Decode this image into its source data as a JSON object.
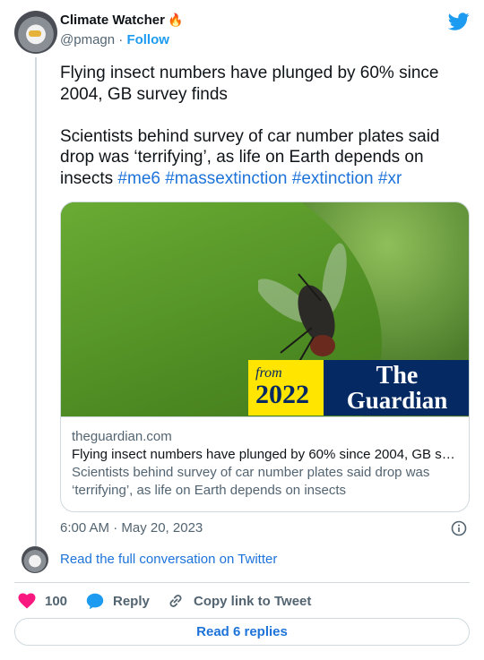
{
  "author": {
    "name": "Climate Watcher",
    "emoji": "🔥",
    "handle": "@pmagn",
    "separator": "·",
    "follow_label": "Follow"
  },
  "tweet": {
    "paragraph1": "Flying insect numbers have plunged by 60% since 2004, GB survey finds",
    "paragraph2_text": "Scientists behind survey of car number plates said drop was ‘terrifying’, as life on Earth depends on insects",
    "hashtags": [
      "#me6",
      "#massextinction",
      "#extinction",
      "#xr"
    ]
  },
  "card": {
    "badge_from": "from",
    "badge_year": "2022",
    "badge_brand_line1": "The",
    "badge_brand_line2": "Guardian",
    "domain": "theguardian.com",
    "title": "Flying insect numbers have plunged by 60% since 2004, GB su…",
    "description": "Scientists behind survey of car number plates said drop was ‘terrifying’, as life on Earth depends on insects"
  },
  "timestamp": "6:00 AM · May 20, 2023",
  "conversation_link": "Read the full conversation on Twitter",
  "actions": {
    "likes_count": "100",
    "reply_label": "Reply",
    "copy_label": "Copy link to Tweet"
  },
  "read_replies_label": "Read 6 replies",
  "colors": {
    "accent": "#1d9bf0",
    "link": "#1d73d9",
    "like": "#f91880",
    "muted": "#536471"
  }
}
